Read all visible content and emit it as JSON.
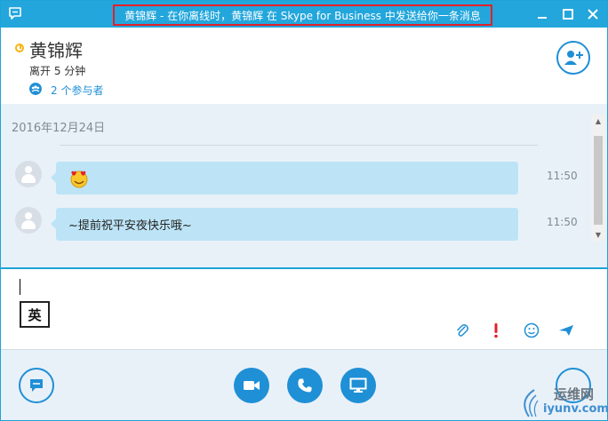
{
  "titlebar": {
    "title": "黄锦辉 - 在你离线时，黄锦辉 在 Skype for Business 中发送给你一条消息"
  },
  "header": {
    "name": "黄锦辉",
    "status": "离开 5 分钟",
    "participants": "2 个参与者"
  },
  "conversation": {
    "date": "2016年12月24日",
    "messages": [
      {
        "text": "",
        "emoji": "heart-eyes-emoticon",
        "time": "11:50"
      },
      {
        "text": "~提前祝平安夜快乐哦~",
        "time": "11:50"
      }
    ]
  },
  "compose": {
    "ime_indicator": "英"
  },
  "watermark": {
    "line1": "运维网",
    "line2": "iyunv.com"
  },
  "colors": {
    "accent": "#22a6dc",
    "bubble": "#bde4f6",
    "highlight_border": "#e5202a",
    "away": "#f6b40e",
    "important": "#e5202a"
  }
}
